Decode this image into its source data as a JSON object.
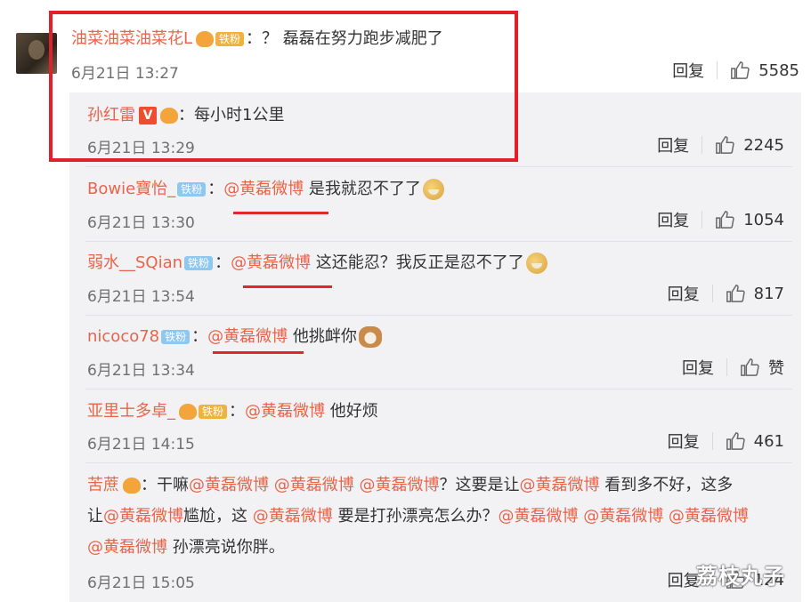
{
  "comments": {
    "main": {
      "user": "油菜油菜油菜花L",
      "crown_level": "2",
      "badge": "铁粉",
      "separator": "：",
      "text": "？ 磊磊在努力跑步减肥了",
      "time": "6月21日 13:27",
      "reply_label": "回复",
      "likes": "5585"
    },
    "replies": [
      {
        "user": "孙红雷",
        "v_badge": "V",
        "separator": "：",
        "text": "每小时1公里",
        "time": "6月21日 13:29",
        "reply_label": "回复",
        "likes": "2245"
      },
      {
        "user": "Bowie寶怡_",
        "badge": "铁粉",
        "separator": "：",
        "mention": "@黄磊微博",
        "text": " 是我就忍不了了",
        "time": "6月21日 13:30",
        "reply_label": "回复",
        "likes": "1054"
      },
      {
        "user": "弱水__SQian",
        "badge": "铁粉",
        "separator": "：",
        "mention": "@黄磊微博",
        "text": " 这还能忍？我反正是忍不了了",
        "time": "6月21日 13:54",
        "reply_label": "回复",
        "likes": "817"
      },
      {
        "user": "nicoco78",
        "badge": "铁粉",
        "separator": "：",
        "mention": "@黄磊微博",
        "text": " 他挑衅你",
        "time": "6月21日 13:34",
        "reply_label": "回复",
        "likes": "赞"
      },
      {
        "user": "亚里士多卓_",
        "crown_level": "5",
        "badge": "铁粉",
        "separator": "：",
        "mention": "@黄磊微博",
        "text": " 他好烦",
        "time": "6月21日 14:15",
        "reply_label": "回复",
        "likes": "461"
      },
      {
        "user": "苦蔗",
        "crown_level": "5",
        "separator": "：",
        "line1_a": "干嘛",
        "line1_m1": "@黄磊微博",
        "line1_m2": " @黄磊微博",
        "line1_m3": " @黄磊微博",
        "line1_b": "？这要是让",
        "line1_m4": "@黄磊微博",
        "line1_c": " 看到多不好，这多",
        "line2_a": "让",
        "line2_m1": "@黄磊微博",
        "line2_b": "尴尬，这 ",
        "line2_m2": "@黄磊微博",
        "line2_c": " 要是打孙漂亮怎么办？",
        "line2_m3": "@黄磊微博",
        "line2_m4": " @黄磊微博",
        "line2_m5": " @黄磊微博",
        "line3_m1": "@黄磊微博",
        "line3_a": " 孙漂亮说你胖。",
        "time": "6月21日 15:05",
        "reply_label": "回复",
        "likes": "124"
      }
    ]
  },
  "watermark": "荔枝丸子",
  "colors": {
    "link": "#e8644a",
    "highlight_box": "#e0212b",
    "reply_bg": "#f2f2f5"
  },
  "icons": {
    "like": "thumbs-up-icon"
  }
}
